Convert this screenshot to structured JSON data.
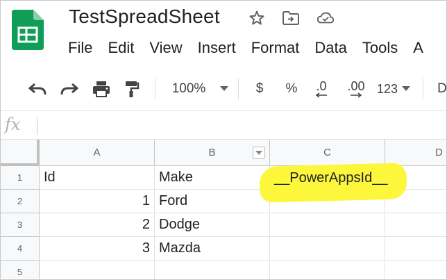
{
  "header": {
    "doc_title": "TestSpreadSheet",
    "icons": [
      "star-icon",
      "move-to-folder-icon",
      "cloud-saved-icon"
    ]
  },
  "menu": {
    "items": [
      "File",
      "Edit",
      "View",
      "Insert",
      "Format",
      "Data",
      "Tools",
      "A"
    ]
  },
  "toolbar": {
    "zoom": "100%",
    "currency": "$",
    "percent": "%",
    "decrease_decimals": ".0",
    "increase_decimals": ".00",
    "more_formats": "123",
    "trailing": "D"
  },
  "formula_bar": {
    "fx_label": "fx",
    "value": ""
  },
  "grid": {
    "columns": [
      "A",
      "B",
      "C",
      "D"
    ],
    "row_numbers": [
      "1",
      "2",
      "3",
      "4",
      "5"
    ],
    "rows": [
      [
        "Id",
        "Make",
        "__PowerAppsId__"
      ],
      [
        "1",
        "Ford",
        ""
      ],
      [
        "2",
        "Dodge",
        ""
      ],
      [
        "3",
        "Mazda",
        ""
      ],
      [
        "",
        "",
        ""
      ]
    ]
  },
  "colors": {
    "sheets_green": "#0F9D58",
    "highlighter_yellow": "#FCF73A",
    "header_bg": "#F8F9FA"
  }
}
